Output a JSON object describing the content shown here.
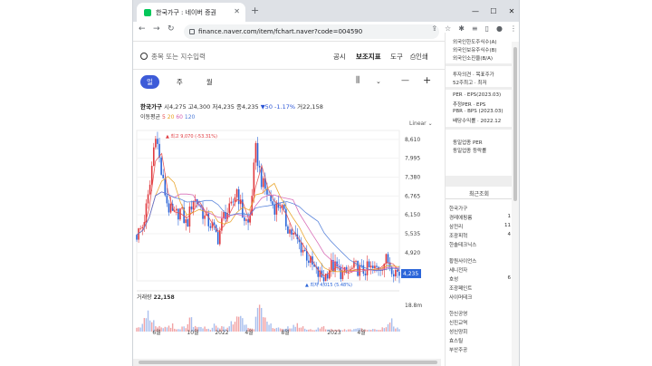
{
  "browser": {
    "tab_title": "한국가구 : 네이버 증권",
    "url": "finance.naver.com/item/fchart.naver?code=004590"
  },
  "toolbar": {
    "search_placeholder": "종목 또는 지수입력",
    "menu": [
      "공시",
      "보조지표",
      "도구",
      "인쇄"
    ]
  },
  "period": {
    "buttons": [
      "일",
      "주",
      "월"
    ],
    "selected": "일"
  },
  "stock": {
    "name": "한국가구",
    "open_label": "시",
    "open": "4,275",
    "high_label": "고",
    "high": "4,300",
    "low_label": "저",
    "low": "4,235",
    "close_label": "종",
    "close": "4,235",
    "change": "▼50 -1.17%",
    "volume_label": "거",
    "volume": "22,158",
    "ma_label": "이동평균",
    "ma": [
      "5",
      "20",
      "60",
      "120"
    ],
    "scale": "Linear"
  },
  "chart_data": {
    "type": "line",
    "title": "",
    "xlabel": "",
    "ylabel": "",
    "x": [
      "6월",
      "10월",
      "2022",
      "4월",
      "8월",
      "2023",
      "4월"
    ],
    "y_ticks": [
      8610,
      7995,
      7380,
      6765,
      6150,
      5535,
      4920
    ],
    "ylim": [
      4000,
      8900
    ],
    "series": [
      {
        "values": [
          5500,
          5800,
          6900,
          8900,
          7400,
          6400,
          6100,
          6300,
          5800,
          6700,
          6500,
          6000,
          5800,
          5400,
          6200,
          6300,
          7000,
          6100,
          5800,
          8300,
          7200,
          6800,
          6400,
          6500,
          5800,
          5500,
          5200,
          4900,
          4500,
          4200,
          4100,
          4500,
          4400,
          4200,
          4300,
          4450,
          4300,
          4400,
          4350,
          4500,
          4700,
          4400,
          4235
        ]
      }
    ],
    "annotations": [
      "최고 9,070 (-53.31%)",
      "최저 4,015 (5.48%)"
    ],
    "last_price_label": "4,235",
    "volume_label": "거래량",
    "volume_value": "22,158",
    "volume_axis": "18.8m",
    "volume": [
      0.3,
      0.9,
      0.4,
      0.2,
      0.2,
      0.3,
      0.1,
      0.2,
      0.5,
      0.2,
      0.2,
      0.1,
      0.3,
      0.2,
      0.2,
      0.4,
      0.8,
      0.3,
      0.2,
      1.0,
      0.5,
      0.3,
      0.2,
      0.1,
      0.2,
      0.3,
      0.2,
      0.1,
      0.1,
      0.2,
      0.1,
      0.1,
      0.1,
      0.1,
      0.1,
      0.2,
      0.1,
      0.1,
      0.1,
      0.2,
      0.6,
      0.2,
      0.1
    ]
  },
  "right_panel": {
    "top_lines": [
      "외국인한도주식수(A)",
      "외국인보유주식수(B)",
      "외국인소진율(B/A)"
    ],
    "mid_lines": [
      "투자의견 · 목표주가",
      "52주최고 · 최저"
    ],
    "per_lines": [
      "PER · EPS(2023.03)",
      "추정PER · EPS",
      "PBR · BPS (2023.03)",
      "배당수익률 · 2022.12"
    ],
    "industry_lines": [
      "동일업종 PER",
      "동일업종 등락률"
    ],
    "recent_title": "최근조회",
    "recent": [
      {
        "name": "한국가구",
        "v": ""
      },
      {
        "name": "경레에핑룸",
        "v": "1"
      },
      {
        "name": "삼전리",
        "v": "11"
      },
      {
        "name": "조광피혁",
        "v": "4"
      },
      {
        "name": "한솔테크닉스",
        "v": ""
      }
    ],
    "recent2": [
      {
        "name": "황원사이언스",
        "v": ""
      },
      {
        "name": "세니전자",
        "v": ""
      },
      {
        "name": "호성",
        "v": "6"
      },
      {
        "name": "조광페인트",
        "v": ""
      },
      {
        "name": "사이머테크",
        "v": ""
      }
    ],
    "recent3": [
      {
        "name": "한신공영",
        "v": ""
      },
      {
        "name": "신진교역",
        "v": ""
      },
      {
        "name": "성신양회",
        "v": ""
      },
      {
        "name": "효스틸",
        "v": ""
      },
      {
        "name": "부산주공",
        "v": ""
      }
    ]
  }
}
